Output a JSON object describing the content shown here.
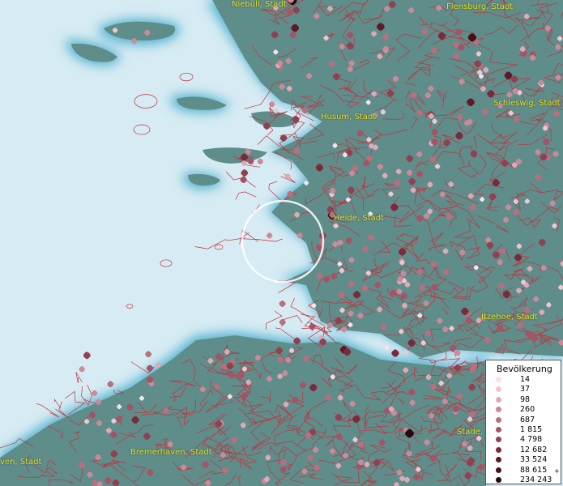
{
  "map": {
    "water_color": "#d6ebf3",
    "coast_halo_color": "#5ab4d0",
    "land_color": "#5e8d8a",
    "boundary_color": "#c2333d",
    "lens_color": "#ffffff"
  },
  "places": [
    {
      "name": "Niebüll, Stadt"
    },
    {
      "name": "Flensburg, Stadt"
    },
    {
      "name": "Schleswig, Stadt"
    },
    {
      "name": "Husum, Stadt"
    },
    {
      "name": "Heide, Stadt"
    },
    {
      "name": "Itzehoe, Stadt"
    },
    {
      "name": "Stade,"
    },
    {
      "name": "Bremerhaven, Stadt"
    },
    {
      "name": "ven, Stadt"
    }
  ],
  "legend": {
    "title": "Bevölkerung",
    "open_ended_mark": "+",
    "classes": [
      {
        "label": "14",
        "color": "#f6e2ea"
      },
      {
        "label": "37",
        "color": "#eec7d2"
      },
      {
        "label": "98",
        "color": "#e0a9b6"
      },
      {
        "label": "260",
        "color": "#cc8a98"
      },
      {
        "label": "687",
        "color": "#b96f7e"
      },
      {
        "label": "1 815",
        "color": "#a65366"
      },
      {
        "label": "4 798",
        "color": "#92404f"
      },
      {
        "label": "12 682",
        "color": "#7a2a3a"
      },
      {
        "label": "33 524",
        "color": "#61192a"
      },
      {
        "label": "88 615",
        "color": "#450f1c"
      },
      {
        "label": "234 243",
        "color": "#2a0610"
      }
    ]
  }
}
